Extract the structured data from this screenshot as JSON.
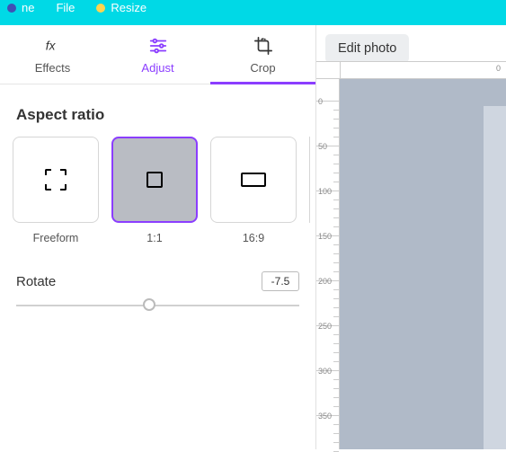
{
  "topbar": {
    "home": "ne",
    "file": "File",
    "resize": "Resize"
  },
  "tabs": {
    "effects": "Effects",
    "adjust": "Adjust",
    "crop": "Crop"
  },
  "aspect": {
    "title": "Aspect ratio",
    "options": [
      {
        "label": "Freeform"
      },
      {
        "label": "1:1"
      },
      {
        "label": "16:9"
      }
    ]
  },
  "rotate": {
    "label": "Rotate",
    "value": "-7.5"
  },
  "edit_photo": "Edit photo",
  "ruler_h": {
    "zero": "0"
  },
  "ruler_v": {
    "t0": "0",
    "t50": "50",
    "t100": "100",
    "t150": "150",
    "t200": "200",
    "t250": "250",
    "t300": "300",
    "t350": "350"
  }
}
